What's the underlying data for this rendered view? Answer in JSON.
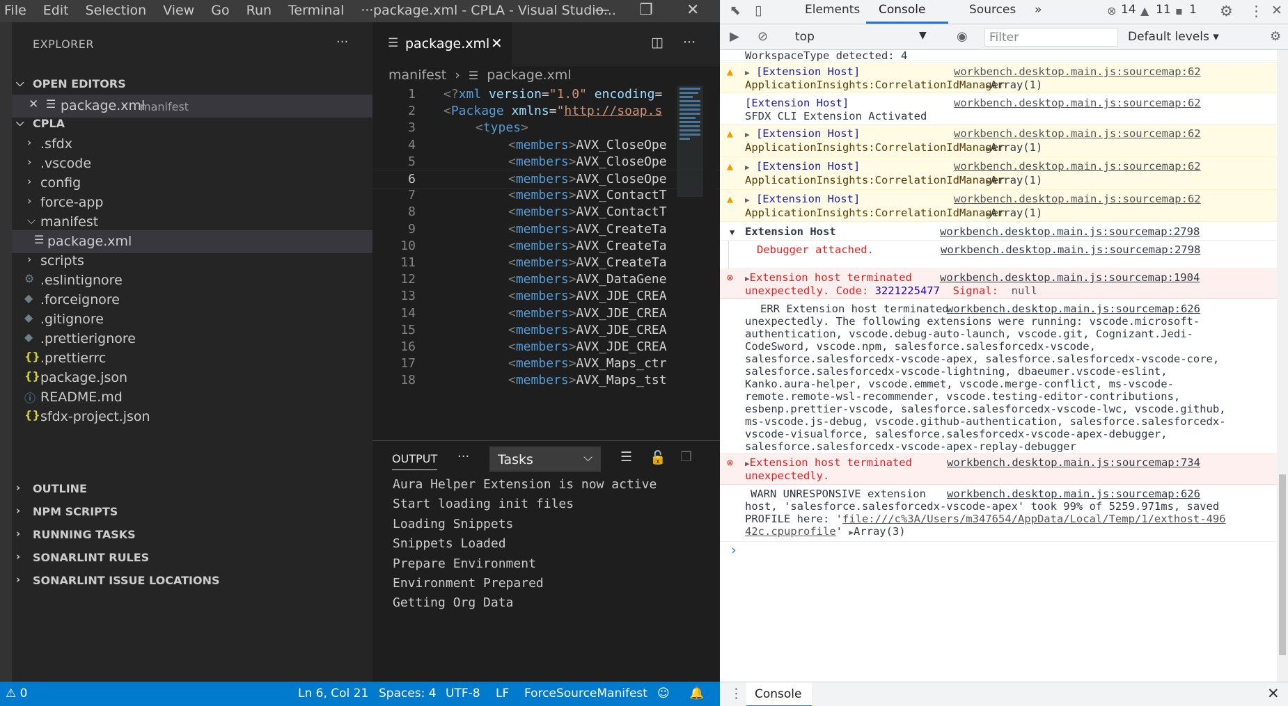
{
  "titlebar": {
    "menu": [
      "File",
      "Edit",
      "Selection",
      "View",
      "Go",
      "Run",
      "Terminal",
      "···"
    ],
    "window_title": "package.xml - CPLA - Visual Studio...",
    "minimize": "—",
    "restore": "❐",
    "close": "✕"
  },
  "explorer": {
    "header": "EXPLORER",
    "more": "···",
    "open_editors": {
      "title": "OPEN EDITORS",
      "items": [
        {
          "close": "✕",
          "name": "package.xml",
          "hint": "manifest"
        }
      ]
    },
    "project": {
      "title": "CPLA",
      "items": [
        {
          "name": ".sfdx",
          "type": "folder",
          "expanded": false
        },
        {
          "name": ".vscode",
          "type": "folder",
          "expanded": false
        },
        {
          "name": "config",
          "type": "folder",
          "expanded": false
        },
        {
          "name": "force-app",
          "type": "folder",
          "expanded": false
        },
        {
          "name": "manifest",
          "type": "folder",
          "expanded": true
        },
        {
          "name": "package.xml",
          "type": "file",
          "icon": "lines-icon",
          "selected": true
        },
        {
          "name": "scripts",
          "type": "folder",
          "expanded": false
        },
        {
          "name": ".eslintignore",
          "type": "file",
          "icon": "gear-icon"
        },
        {
          "name": ".forceignore",
          "type": "file",
          "icon": "diamond-icon"
        },
        {
          "name": ".gitignore",
          "type": "file",
          "icon": "diamond-icon"
        },
        {
          "name": ".prettierignore",
          "type": "file",
          "icon": "diamond-icon"
        },
        {
          "name": ".prettierrc",
          "type": "file",
          "icon": "json-icon"
        },
        {
          "name": "package.json",
          "type": "file",
          "icon": "json-icon"
        },
        {
          "name": "README.md",
          "type": "file",
          "icon": "info-icon"
        },
        {
          "name": "sfdx-project.json",
          "type": "file",
          "icon": "json-icon"
        }
      ]
    },
    "sections": [
      "OUTLINE",
      "NPM SCRIPTS",
      "RUNNING TASKS",
      "SONARLINT RULES",
      "SONARLINT ISSUE LOCATIONS"
    ]
  },
  "editor": {
    "tab_label": "package.xml",
    "tab_close": "✕",
    "breadcrumb": [
      "manifest",
      "package.xml"
    ],
    "current_line": 6,
    "lines": [
      {
        "n": "1",
        "indent": 0,
        "parts": [
          [
            "pun",
            "<?"
          ],
          [
            "tag",
            "xml "
          ],
          [
            "attr",
            "version"
          ],
          [
            "plain",
            "="
          ],
          [
            "str",
            "\"1.0\" "
          ],
          [
            "attr",
            "encoding"
          ],
          [
            "plain",
            "="
          ]
        ]
      },
      {
        "n": "2",
        "indent": 0,
        "parts": [
          [
            "pun",
            "<"
          ],
          [
            "tag",
            "Package "
          ],
          [
            "attr",
            "xmlns"
          ],
          [
            "plain",
            "="
          ],
          [
            "str",
            "\""
          ],
          [
            "url",
            "http://soap.s"
          ]
        ]
      },
      {
        "n": "3",
        "indent": 1,
        "parts": [
          [
            "pun",
            "<"
          ],
          [
            "tag",
            "types"
          ],
          [
            "pun",
            ">"
          ]
        ]
      },
      {
        "n": "4",
        "indent": 2,
        "parts": [
          [
            "pun",
            "<"
          ],
          [
            "tag",
            "members"
          ],
          [
            "pun",
            ">"
          ],
          [
            "plain",
            "AVX_CloseOpe"
          ]
        ]
      },
      {
        "n": "5",
        "indent": 2,
        "parts": [
          [
            "pun",
            "<"
          ],
          [
            "tag",
            "members"
          ],
          [
            "pun",
            ">"
          ],
          [
            "plain",
            "AVX_CloseOpe"
          ]
        ]
      },
      {
        "n": "6",
        "indent": 2,
        "parts": [
          [
            "pun",
            "<"
          ],
          [
            "tag",
            "members"
          ],
          [
            "pun",
            ">"
          ],
          [
            "plain",
            "AVX_CloseOpe"
          ]
        ]
      },
      {
        "n": "7",
        "indent": 2,
        "parts": [
          [
            "pun",
            "<"
          ],
          [
            "tag",
            "members"
          ],
          [
            "pun",
            ">"
          ],
          [
            "plain",
            "AVX_ContactT"
          ]
        ]
      },
      {
        "n": "8",
        "indent": 2,
        "parts": [
          [
            "pun",
            "<"
          ],
          [
            "tag",
            "members"
          ],
          [
            "pun",
            ">"
          ],
          [
            "plain",
            "AVX_ContactT"
          ]
        ]
      },
      {
        "n": "9",
        "indent": 2,
        "parts": [
          [
            "pun",
            "<"
          ],
          [
            "tag",
            "members"
          ],
          [
            "pun",
            ">"
          ],
          [
            "plain",
            "AVX_CreateTa"
          ]
        ]
      },
      {
        "n": "10",
        "indent": 2,
        "parts": [
          [
            "pun",
            "<"
          ],
          [
            "tag",
            "members"
          ],
          [
            "pun",
            ">"
          ],
          [
            "plain",
            "AVX_CreateTa"
          ]
        ]
      },
      {
        "n": "11",
        "indent": 2,
        "parts": [
          [
            "pun",
            "<"
          ],
          [
            "tag",
            "members"
          ],
          [
            "pun",
            ">"
          ],
          [
            "plain",
            "AVX_CreateTa"
          ]
        ]
      },
      {
        "n": "12",
        "indent": 2,
        "parts": [
          [
            "pun",
            "<"
          ],
          [
            "tag",
            "members"
          ],
          [
            "pun",
            ">"
          ],
          [
            "plain",
            "AVX_DataGene"
          ]
        ]
      },
      {
        "n": "13",
        "indent": 2,
        "parts": [
          [
            "pun",
            "<"
          ],
          [
            "tag",
            "members"
          ],
          [
            "pun",
            ">"
          ],
          [
            "plain",
            "AVX_JDE_CREA"
          ]
        ]
      },
      {
        "n": "14",
        "indent": 2,
        "parts": [
          [
            "pun",
            "<"
          ],
          [
            "tag",
            "members"
          ],
          [
            "pun",
            ">"
          ],
          [
            "plain",
            "AVX_JDE_CREA"
          ]
        ]
      },
      {
        "n": "15",
        "indent": 2,
        "parts": [
          [
            "pun",
            "<"
          ],
          [
            "tag",
            "members"
          ],
          [
            "pun",
            ">"
          ],
          [
            "plain",
            "AVX_JDE_CREA"
          ]
        ]
      },
      {
        "n": "16",
        "indent": 2,
        "parts": [
          [
            "pun",
            "<"
          ],
          [
            "tag",
            "members"
          ],
          [
            "pun",
            ">"
          ],
          [
            "plain",
            "AVX_JDE_CREA"
          ]
        ]
      },
      {
        "n": "17",
        "indent": 2,
        "parts": [
          [
            "pun",
            "<"
          ],
          [
            "tag",
            "members"
          ],
          [
            "pun",
            ">"
          ],
          [
            "plain",
            "AVX_Maps_ctr"
          ]
        ]
      },
      {
        "n": "18",
        "indent": 2,
        "parts": [
          [
            "pun",
            "<"
          ],
          [
            "tag",
            "members"
          ],
          [
            "pun",
            ">"
          ],
          [
            "plain",
            "AVX_Maps_tst"
          ]
        ]
      }
    ]
  },
  "panel": {
    "tab": "OUTPUT",
    "more": "···",
    "select_value": "Tasks",
    "lines": [
      "Aura Helper Extension is now active",
      "Start loading init files",
      "Loading Snippets",
      "Snippets Loaded",
      "Prepare Environment",
      "Environment Prepared",
      "Getting Org Data"
    ]
  },
  "statusbar": {
    "problems": "⚠ 0",
    "position": "Ln 6, Col 21",
    "spaces": "Spaces: 4",
    "encoding": "UTF-8",
    "eol": "LF",
    "mode": "ForceSourceManifest"
  },
  "devtools": {
    "tabs": [
      "Elements",
      "Console",
      "Sources",
      "»"
    ],
    "active_tab": "Console",
    "errors": "14",
    "warnings": "11",
    "infos": "1",
    "context": "top",
    "filter_placeholder": "Filter",
    "levels": "Default levels ▾",
    "drawer_tab": "Console",
    "drawer_close": "✕",
    "messages": {
      "m0_text": "WorkspaceType detected: 4",
      "m1_a": "[Extension Host]",
      "m1_b": "ApplicationInsights:CorrelationIdManager",
      "m1_arr": "Array(1)",
      "m1_src": "workbench.desktop.main.js:sourcemap:62",
      "m2_a": "[Extension Host]",
      "m2_b": "SFDX CLI Extension Activated",
      "m2_src": "workbench.desktop.main.js:sourcemap:62",
      "m3_a": "[Extension Host]",
      "m3_b": "ApplicationInsights:CorrelationIdManager",
      "m3_arr": "Array(1)",
      "m3_src": "workbench.desktop.main.js:sourcemap:62",
      "m4_a": "[Extension Host]",
      "m4_b": "ApplicationInsights:CorrelationIdManager",
      "m4_arr": "Array(1)",
      "m4_src": "workbench.desktop.main.js:sourcemap:62",
      "m5_a": "[Extension Host]",
      "m5_b": "ApplicationInsights:CorrelationIdManager",
      "m5_arr": "Array(1)",
      "m5_src": "workbench.desktop.main.js:sourcemap:62",
      "g_title": "Extension Host",
      "g_src": "workbench.desktop.main.js:sourcemap:2798",
      "g_dbg": "Debugger attached.",
      "g_dbg_src": "workbench.desktop.main.js:sourcemap:2798",
      "e1_a": "Extension host terminated",
      "e1_b": "unexpectedly. Code: ",
      "e1_code": "3221225477",
      "e1_sig": "  Signal: ",
      "e1_null": " null",
      "e1_src": "workbench.desktop.main.js:sourcemap:1904",
      "err_line1": "ERR Extension host terminated",
      "err_src": "workbench.desktop.main.js:sourcemap:626",
      "err_rest": [
        "unexpectedly. The following extensions were running: vscode.microsoft-",
        "authentication, vscode.debug-auto-launch, vscode.git, Cognizant.Jedi-",
        "CodeSword, vscode.npm, salesforce.salesforcedx-vscode,",
        "salesforce.salesforcedx-vscode-apex, salesforce.salesforcedx-vscode-core,",
        "salesforce.salesforcedx-vscode-lightning, dbaeumer.vscode-eslint,",
        "Kanko.aura-helper, vscode.emmet, vscode.merge-conflict, ms-vscode-",
        "remote.remote-wsl-recommender, vscode.testing-editor-contributions,",
        "esbenp.prettier-vscode, salesforce.salesforcedx-vscode-lwc, vscode.github,",
        "ms-vscode.js-debug, vscode.github-authentication, salesforce.salesforcedx-",
        "vscode-visualforce, salesforce.salesforcedx-vscode-apex-debugger,",
        "salesforce.salesforcedx-vscode-apex-replay-debugger"
      ],
      "e2_a": "Extension host terminated",
      "e2_b": "unexpectedly.",
      "e2_src": "workbench.desktop.main.js:sourcemap:734",
      "warn_a": "WARN UNRESPONSIVE extension",
      "warn_src": "workbench.desktop.main.js:sourcemap:626",
      "warn_b": "host, 'salesforce.salesforcedx-vscode-apex' took 99% of 5259.971ms, saved",
      "warn_c1": "PROFILE here: '",
      "warn_c_link": "file:///c%3A/Users/m347654/AppData/Local/Temp/1/exthost-496",
      "warn_d_link": "42c.cpuprofile",
      "warn_d2": "'",
      "warn_arr": "Array(3)",
      "prompt": "›"
    }
  },
  "colors": {
    "statusbar": "#007acc",
    "accent": "#1a73e8",
    "error": "#d93025",
    "warning": "#f29900"
  }
}
